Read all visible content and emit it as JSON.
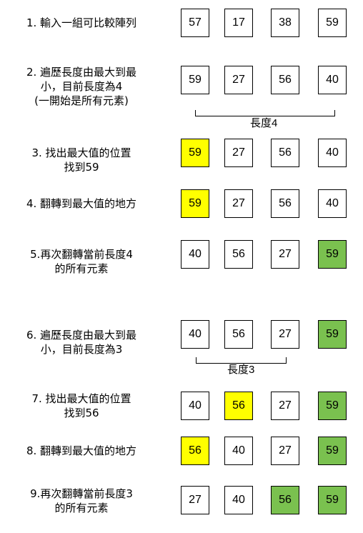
{
  "steps": [
    {
      "lines": [
        "1. 輸入一組可比較陣列"
      ]
    },
    {
      "lines": [
        "2. 遍歷長度由最大到最",
        "小，目前長度為4",
        "(一開始是所有元素)"
      ]
    },
    {
      "lines": [
        "3. 找出最大值的位置",
        "找到59"
      ]
    },
    {
      "lines": [
        "4. 翻轉到最大值的地方"
      ]
    },
    {
      "lines": [
        "5.再次翻轉當前長度4",
        "的所有元素"
      ]
    },
    {
      "lines": [
        "6. 遍歷長度由最大到最",
        "小，目前長度為3"
      ]
    },
    {
      "lines": [
        "7. 找出最大值的位置",
        "找到56"
      ]
    },
    {
      "lines": [
        "8. 翻轉到最大值的地方"
      ]
    },
    {
      "lines": [
        "9.再次翻轉當前長度3",
        "的所有元素"
      ]
    }
  ],
  "rows": [
    {
      "values": [
        "57",
        "17",
        "38",
        "59"
      ],
      "fills": [
        "white",
        "white",
        "white",
        "white"
      ]
    },
    {
      "values": [
        "59",
        "27",
        "56",
        "40"
      ],
      "fills": [
        "white",
        "white",
        "white",
        "white"
      ]
    },
    {
      "values": [
        "59",
        "27",
        "56",
        "40"
      ],
      "fills": [
        "yellow",
        "white",
        "white",
        "white"
      ]
    },
    {
      "values": [
        "59",
        "27",
        "56",
        "40"
      ],
      "fills": [
        "yellow",
        "white",
        "white",
        "white"
      ]
    },
    {
      "values": [
        "40",
        "56",
        "27",
        "59"
      ],
      "fills": [
        "white",
        "white",
        "white",
        "green"
      ]
    },
    {
      "values": [
        "40",
        "56",
        "27",
        "59"
      ],
      "fills": [
        "white",
        "white",
        "white",
        "green"
      ]
    },
    {
      "values": [
        "40",
        "56",
        "27",
        "59"
      ],
      "fills": [
        "white",
        "yellow",
        "white",
        "green"
      ]
    },
    {
      "values": [
        "56",
        "40",
        "27",
        "59"
      ],
      "fills": [
        "yellow",
        "white",
        "white",
        "green"
      ]
    },
    {
      "values": [
        "27",
        "40",
        "56",
        "59"
      ],
      "fills": [
        "white",
        "white",
        "green",
        "green"
      ]
    }
  ],
  "brackets": [
    {
      "label": "長度4"
    },
    {
      "label": "長度3"
    }
  ],
  "colors": {
    "yellow": "#ffff00",
    "green": "#7ac14f",
    "border": "#000000"
  }
}
